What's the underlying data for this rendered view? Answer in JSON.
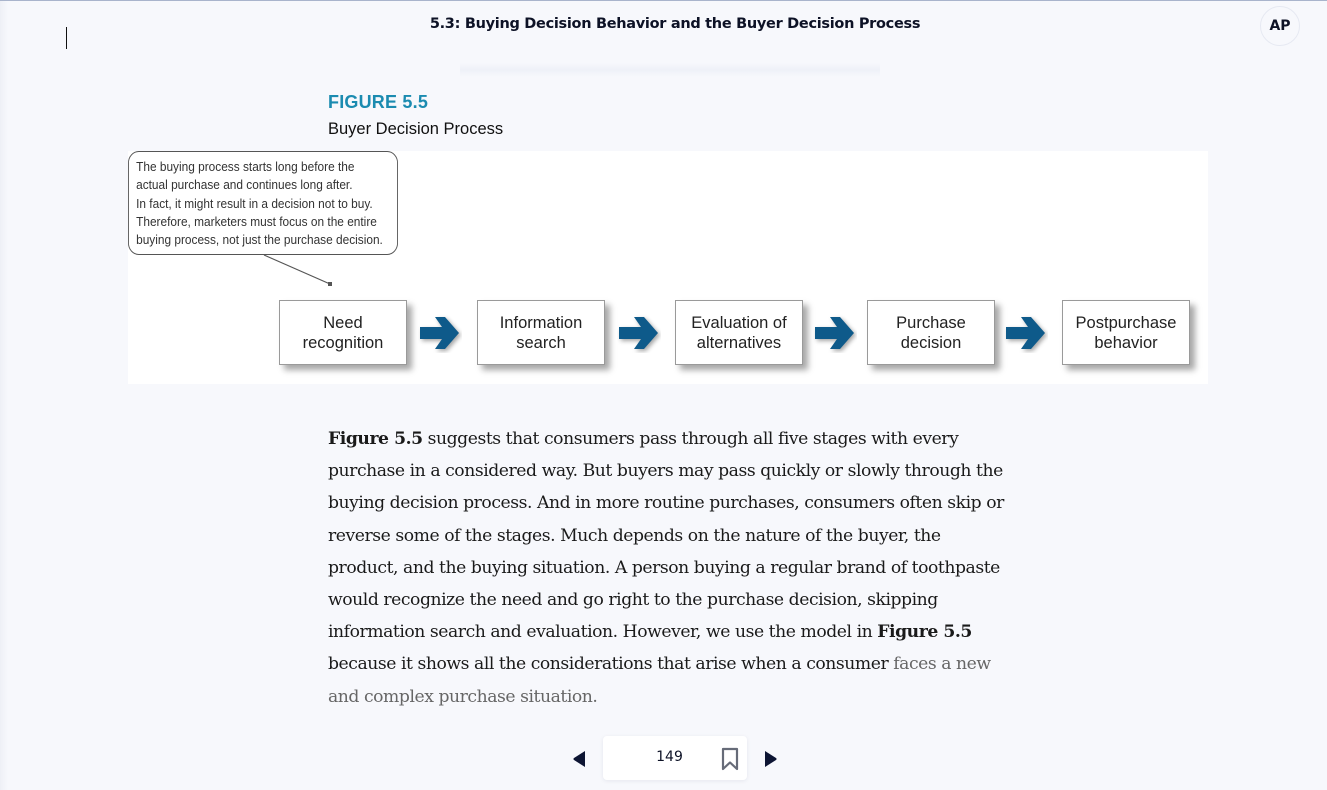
{
  "header": {
    "title": "5.3: Buying Decision Behavior and the Buyer Decision Process",
    "avatar_initials": "AP"
  },
  "figure": {
    "label": "FIGURE 5.5",
    "caption": "Buyer Decision Process",
    "callout_lines": [
      "The buying process starts long before the",
      "actual purchase and continues long after.",
      "In fact, it might result in a decision not to buy.",
      "Therefore, marketers must focus on the entire",
      "buying process, not just the purchase decision."
    ],
    "stages": [
      {
        "line1": "Need",
        "line2": "recognition"
      },
      {
        "line1": "Information",
        "line2": "search"
      },
      {
        "line1": "Evaluation of",
        "line2": "alternatives"
      },
      {
        "line1": "Purchase",
        "line2": "decision"
      },
      {
        "line1": "Postpurchase",
        "line2": "behavior"
      }
    ],
    "arrow_color": "#0e5a8a"
  },
  "body": {
    "p1_bold": "Figure 5.5",
    "p1_rest": " suggests that consumers pass through all five stages with every purchase in a considered way. But buyers may pass quickly or slowly through the buying decision process. And in more routine purchases, consumers often skip or reverse some of the stages. Much depends on the nature of the buyer, the product, and the buying situation. A person buying a regular brand of toothpaste would recognize the need and go right to the purchase decision, skipping information search and evaluation. However, we use the model in ",
    "p2_bold": "Figure 5.5",
    "p2_rest": " because it shows all the considerations that arise when a consumer ",
    "p2_faded": "faces a new and complex purchase situation."
  },
  "pager": {
    "page_number": "149",
    "prev_icon": "triangle-left",
    "next_icon": "triangle-right",
    "bookmark_icon": "bookmark-outline"
  }
}
